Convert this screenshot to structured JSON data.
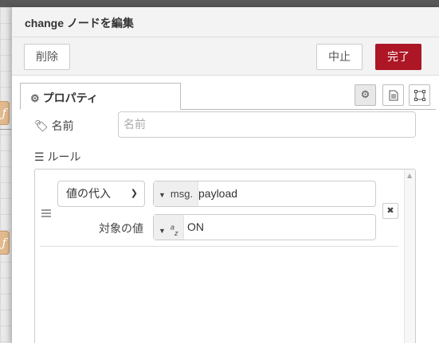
{
  "tray": {
    "title": "change ノードを編集",
    "delete_label": "削除",
    "cancel_label": "中止",
    "done_label": "完了"
  },
  "tabs": {
    "properties_label": "プロパティ",
    "icons": [
      "gear-icon",
      "document-icon",
      "frame-icon"
    ]
  },
  "form": {
    "name_label": "名前",
    "name_placeholder": "名前",
    "rules_label": "ルール"
  },
  "rule": {
    "action": "値の代入",
    "property_type": "msg.",
    "property_value": "payload",
    "target_label": "対象の値",
    "target_type": "az",
    "target_value": "ON"
  },
  "colors": {
    "accent": "#ad1625",
    "node": "#e2b98c"
  }
}
